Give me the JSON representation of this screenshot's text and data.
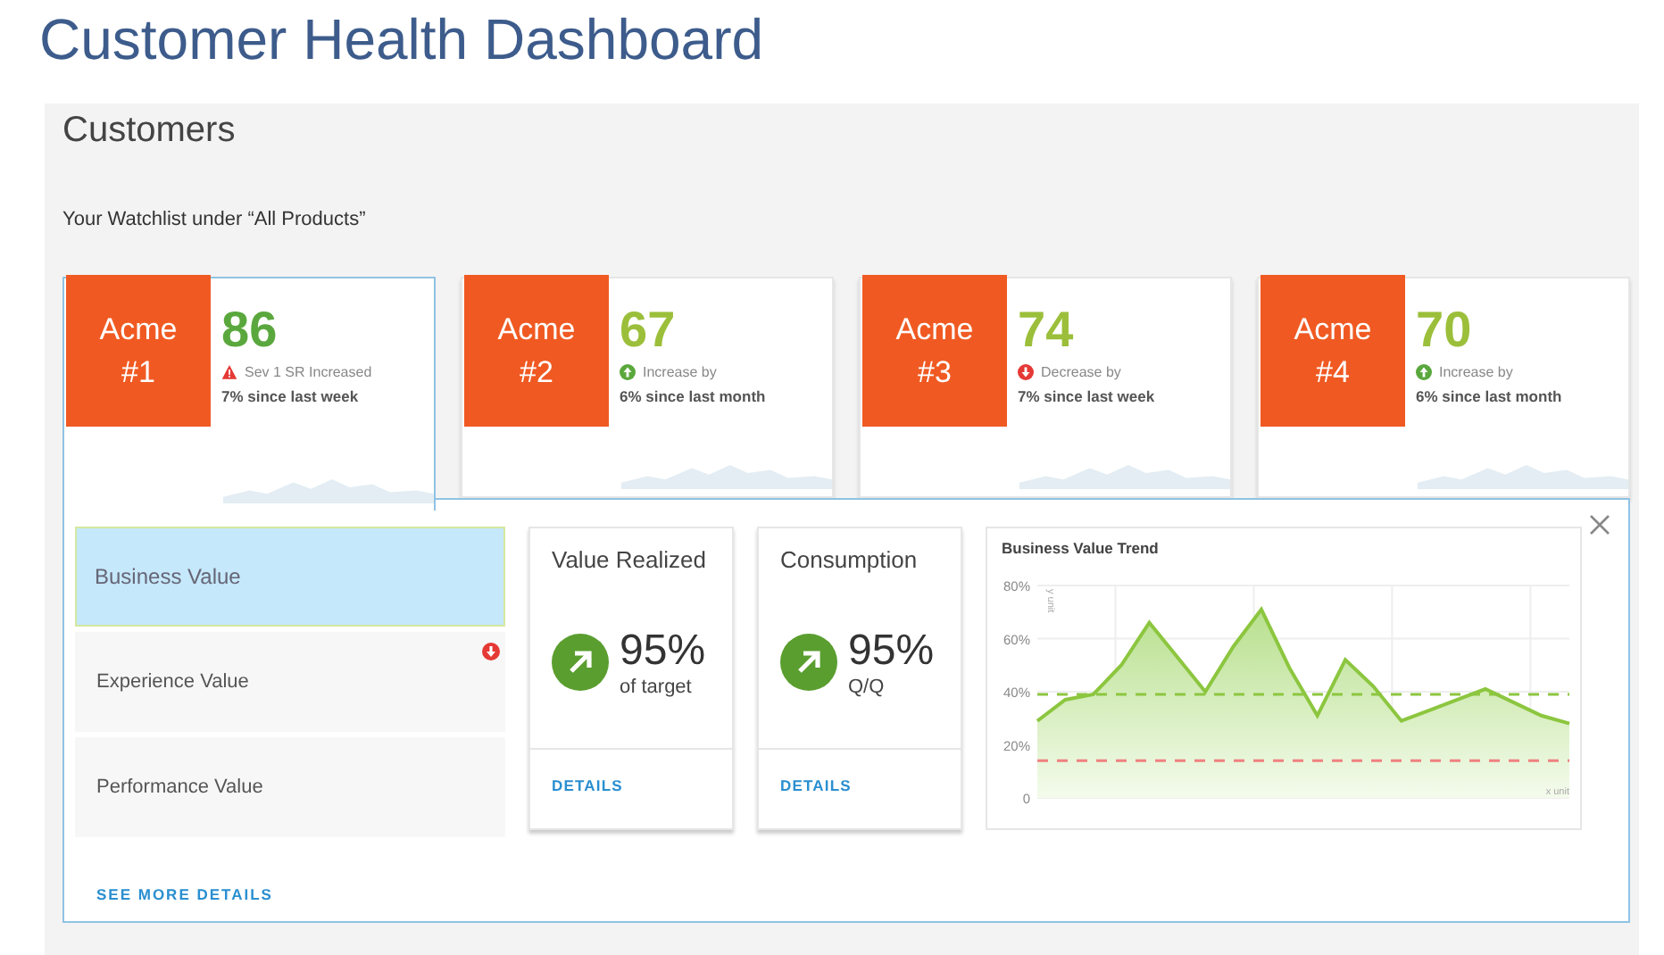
{
  "title": "Customer Health Dashboard",
  "panel": {
    "heading": "Customers",
    "subheading": "Your Watchlist under “All Products”"
  },
  "customers": [
    {
      "label": "Acme #1",
      "score": "86",
      "color": "#5aa83d",
      "kind": "warning",
      "status_text": "Sev 1 SR Increased",
      "change": "7% since last week",
      "selected": true
    },
    {
      "label": "Acme #2",
      "score": "67",
      "color": "#9bbf3a",
      "kind": "up",
      "status_text": "Increase by",
      "change": "6% since last month",
      "selected": false
    },
    {
      "label": "Acme #3",
      "score": "74",
      "color": "#9bbf3a",
      "kind": "down",
      "status_text": "Decrease by",
      "change": "7% since last week",
      "selected": false
    },
    {
      "label": "Acme #4",
      "score": "70",
      "color": "#9bbf3a",
      "kind": "up",
      "status_text": "Increase by",
      "change": "6% since last month",
      "selected": false
    }
  ],
  "detail": {
    "tabs": [
      {
        "label": "Business Value",
        "selected": true,
        "alert": false
      },
      {
        "label": "Experience Value",
        "selected": false,
        "alert": true
      },
      {
        "label": "Performance Value",
        "selected": false,
        "alert": false
      }
    ],
    "more_link": "SEE MORE DETAILS",
    "metrics": [
      {
        "title": "Value Realized",
        "value": "95%",
        "caption": "of target",
        "link": "DETAILS"
      },
      {
        "title": "Consumption",
        "value": "95%",
        "caption": "Q/Q",
        "link": "DETAILS"
      }
    ],
    "trend": {
      "chart_data": {
        "type": "area",
        "title": "Business Value Trend",
        "xlabel": "x unit",
        "ylabel": "y unit",
        "categories": [
          null,
          null,
          null,
          null,
          null,
          null,
          null,
          null,
          null,
          null,
          null,
          null,
          null,
          null,
          null,
          null,
          null,
          null,
          null,
          null
        ],
        "series": [
          {
            "color": "#8cc63f",
            "values": [
              29,
              37,
              39,
              50,
              66,
              53,
              40,
              57,
              71,
              49,
              31,
              52,
              42,
              29,
              33,
              37,
              41,
              36,
              31,
              28
            ]
          },
          {
            "type": "line",
            "line_style": "dashed",
            "color": "#8cc63f",
            "values": [
              39,
              39,
              39,
              39,
              39,
              39,
              39,
              39,
              39,
              39,
              39,
              39,
              39,
              39,
              39,
              39,
              39,
              39,
              39,
              39
            ]
          },
          {
            "type": "line",
            "line_style": "dashed",
            "color": "#f08080",
            "values": [
              14,
              14,
              14,
              14,
              14,
              14,
              14,
              14,
              14,
              14,
              14,
              14,
              14,
              14,
              14,
              14,
              14,
              14,
              14,
              14
            ]
          }
        ],
        "ylim": [
          0,
          80
        ],
        "yticks": [
          {
            "value": 0,
            "label": "0"
          },
          {
            "value": 20,
            "label": "20%"
          },
          {
            "value": 40,
            "label": "40%"
          },
          {
            "value": 60,
            "label": "60%"
          },
          {
            "value": 80,
            "label": "80%"
          }
        ]
      }
    }
  }
}
